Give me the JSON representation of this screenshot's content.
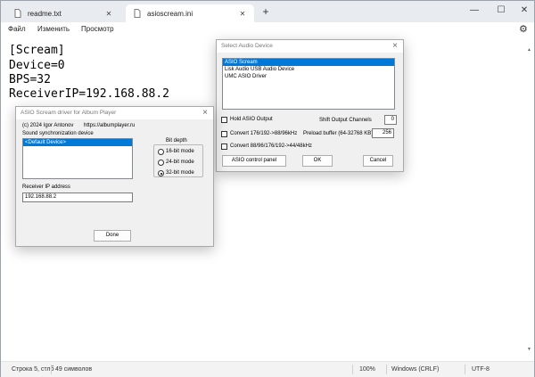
{
  "tabs": [
    {
      "label": "readme.txt",
      "active": false
    },
    {
      "label": "asioscream.ini",
      "active": true
    }
  ],
  "tab_add_label": "+",
  "window_controls": {
    "minimize": "—",
    "maximize": "☐",
    "close": "✕"
  },
  "menu": {
    "file": "Файл",
    "edit": "Изменить",
    "view": "Просмотр"
  },
  "editor": {
    "lines": [
      "[Scream]",
      "Device=0",
      "BPS=32",
      "ReceiverIP=192.168.88.2"
    ]
  },
  "status": {
    "position": "Строка 5, стлб",
    "count": "49 символов",
    "zoom": "100%",
    "line_endings": "Windows (CRLF)",
    "encoding": "UTF-8"
  },
  "device_dialog": {
    "title": "Select Audio Device",
    "devices": [
      {
        "label": "ASIO Scream",
        "selected": true
      },
      {
        "label": "Lisk Audio USB Audio Device",
        "selected": false
      },
      {
        "label": "UMC ASIO Driver",
        "selected": false
      }
    ],
    "hold_output_label": "Hold ASIO Output",
    "shift_channels_label": "Shift Output Channels",
    "shift_channels_value": "0",
    "convert1_label": "Convert 176/192->88/96kHz",
    "preload_label": "Preload buffer (64-32768 KB)",
    "preload_value": "256",
    "convert2_label": "Convert 88/96/176/192->44/48kHz",
    "control_panel_label": "ASIO control panel",
    "ok_label": "OK",
    "cancel_label": "Cancel"
  },
  "driver_dialog": {
    "title": "ASIO Scream driver for Album Player",
    "author": "(c) 2024 Igor Antonov",
    "url": "https://albumplayer.ru",
    "sync_label": "Sound synchronization device",
    "sync_devices": [
      {
        "label": "<Default Device>",
        "selected": true
      }
    ],
    "bit_depth_label": "Bit depth",
    "bit_modes": [
      {
        "label": "16-bit mode",
        "checked": false
      },
      {
        "label": "24-bit mode",
        "checked": false
      },
      {
        "label": "32-bit mode",
        "checked": true
      }
    ],
    "receiver_ip_label": "Receiver IP address",
    "receiver_ip_value": "192.168.88.2",
    "done_label": "Done"
  },
  "icons": {
    "tab_file": "file-icon",
    "settings": "gear-icon"
  }
}
